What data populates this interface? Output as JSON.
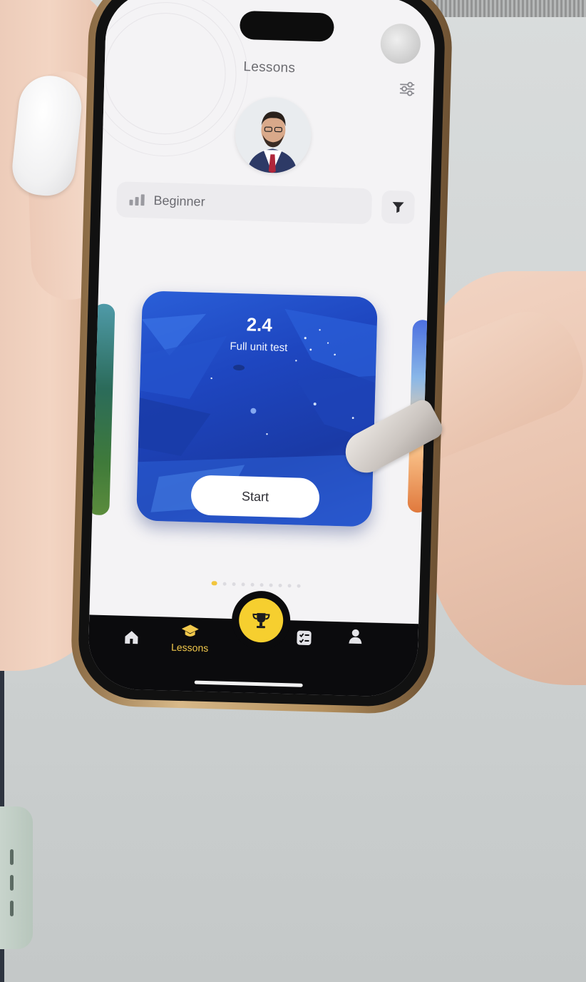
{
  "screen": {
    "title": "Lessons"
  },
  "level": {
    "label": "Beginner"
  },
  "card": {
    "number": "2.4",
    "subtitle": "Full unit test",
    "start_label": "Start"
  },
  "pager": {
    "total": 10,
    "active_index": 0
  },
  "tabbar": {
    "items": [
      {
        "icon": "home-icon",
        "label": ""
      },
      {
        "icon": "graduation-cap-icon",
        "label": "Lessons"
      },
      {
        "icon": "trophy-icon",
        "label": ""
      },
      {
        "icon": "checklist-icon",
        "label": ""
      },
      {
        "icon": "profile-icon",
        "label": ""
      }
    ],
    "active": "Lessons"
  },
  "colors": {
    "accent": "#f6cf2f",
    "card_blue": "#1e46c0",
    "tabbar": "#0b0b0d"
  }
}
